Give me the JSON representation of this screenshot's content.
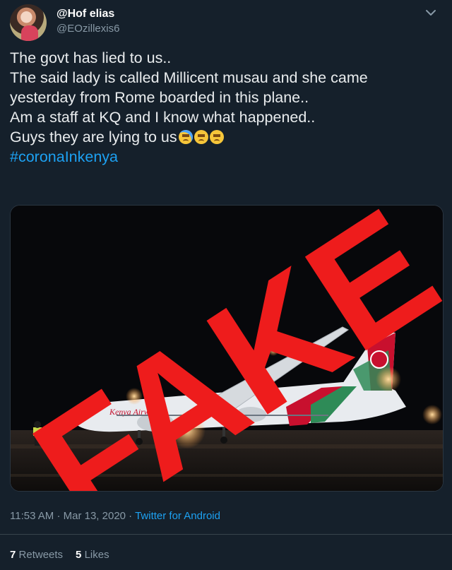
{
  "header": {
    "display_name": "@Hof elias",
    "handle": "@EOzillexis6"
  },
  "tweet": {
    "lines": [
      "The govt has lied to us..",
      "The said lady is called Millicent musau and she came",
      "yesterday from Rome boarded in this plane..",
      "Am a staff at KQ and I know what happened..",
      "Guys they are lying to us"
    ],
    "hashtag": "#coronaInkenya"
  },
  "media": {
    "overlay_text": "FAKE",
    "overlay_color": "#ee1c1c",
    "aircraft_livery": "Kenya Airways"
  },
  "meta": {
    "time": "11:53 AM",
    "date": "Mar 13, 2020",
    "source": "Twitter for Android"
  },
  "stats": {
    "retweets_count": "7",
    "retweets_label": "Retweets",
    "likes_count": "5",
    "likes_label": "Likes"
  },
  "colors": {
    "background": "#15202b",
    "link": "#1da1f2",
    "secondary_text": "#8899a6"
  }
}
